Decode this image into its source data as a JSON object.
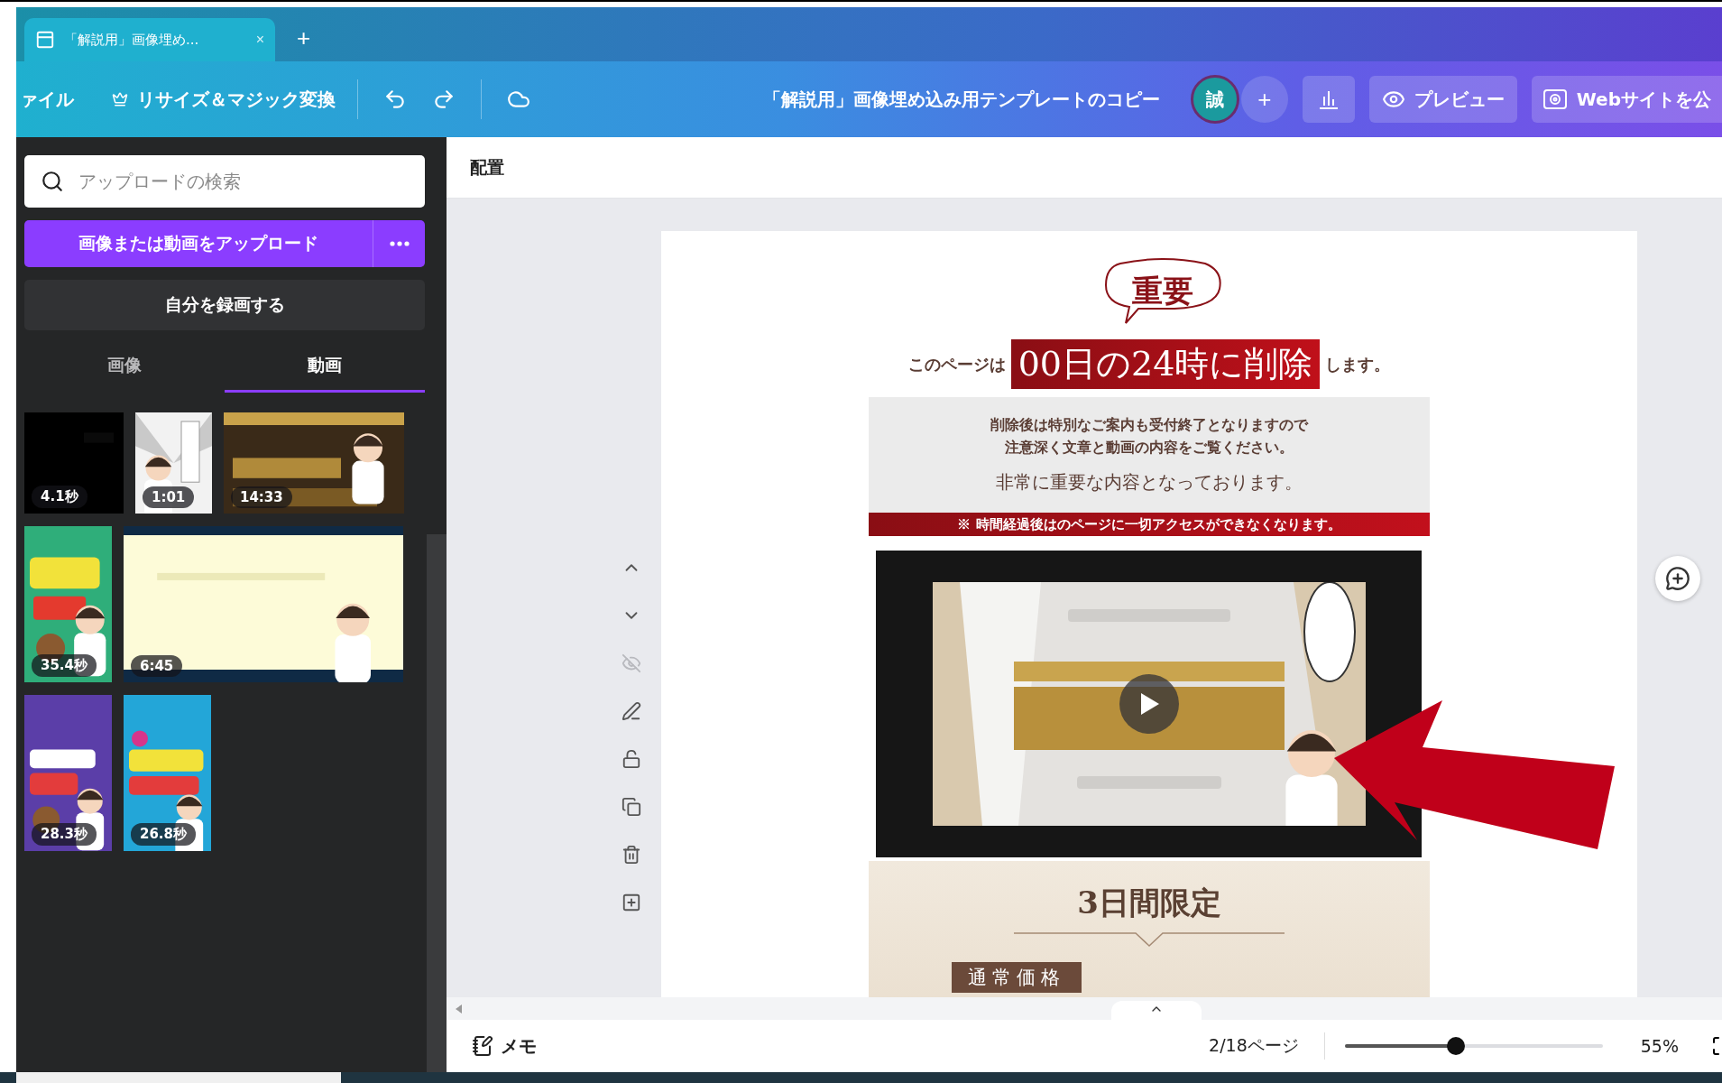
{
  "browser_tab": {
    "title": "「解説用」画像埋め...",
    "close": "×",
    "new_tab": "+"
  },
  "toolbar": {
    "file_menu": "ァイル",
    "resize": "リサイズ＆マジック変換",
    "document_title": "「解説用」画像埋め込み用テンプレートのコピー",
    "avatar": "誠",
    "add": "+",
    "preview": "プレビュー",
    "publish": "Webサイトを公"
  },
  "side_panel": {
    "search": {
      "placeholder": "アップロードの検索"
    },
    "upload_button": "画像または動画をアップロード",
    "record_button": "自分を録画する",
    "tabs": [
      {
        "label": "画像",
        "selected": false
      },
      {
        "label": "動画",
        "selected": true
      }
    ],
    "videos": [
      {
        "duration": "4.1秒"
      },
      {
        "duration": "1:01"
      },
      {
        "duration": "14:33"
      },
      {
        "duration": "35.4秒"
      },
      {
        "duration": "6:45"
      },
      {
        "duration": "28.3秒"
      },
      {
        "duration": "26.8秒"
      }
    ]
  },
  "canvas": {
    "header": "配置",
    "design": {
      "badge": "重要",
      "notice_prefix": "このページは",
      "notice_highlight": "00日の24時に削除",
      "notice_suffix": "します。",
      "info_lines": [
        "削除後は特別なご案内も受付終了となりますので",
        "注意深く文章と動画の内容をご覧ください。"
      ],
      "emphasis": "非常に重要な内容となっております。",
      "warning": "※ 時間経過後はのページに一切アクセスができなくなります。",
      "offer_title": "3日間限定",
      "price_tag": "通常価格"
    }
  },
  "bottom_bar": {
    "notes": "メモ",
    "page_indicator": "2/18ページ",
    "zoom": {
      "level": 0.43
    },
    "zoom_reading": "55%"
  }
}
